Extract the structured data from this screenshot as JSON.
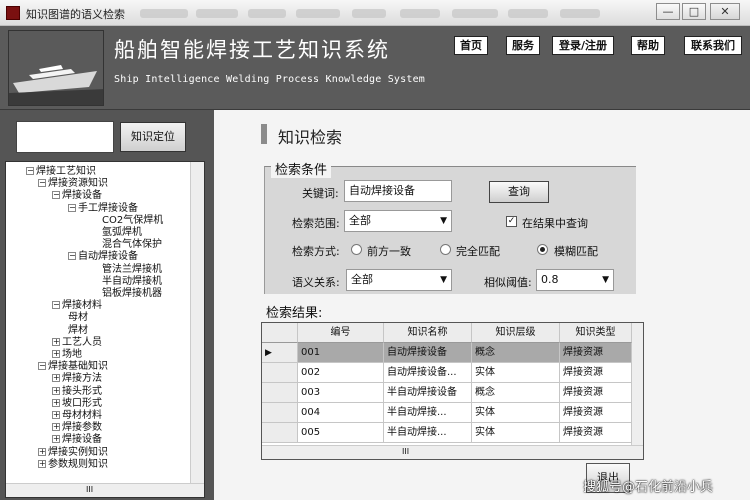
{
  "window": {
    "title": "知识图谱的语义检索",
    "minimize": "—",
    "maximize": "□",
    "close": "✕"
  },
  "header": {
    "title": "船舶智能焊接工艺知识系统",
    "subtitle": "Ship Intelligence Welding Process Knowledge System",
    "nav": [
      "首页",
      "服务",
      "登录/注册",
      "帮助",
      "联系我们"
    ]
  },
  "left": {
    "search_value": "",
    "locate_button": "知识定位",
    "tree": [
      {
        "label": "焊接工艺知识",
        "level": 0,
        "exp": "−"
      },
      {
        "label": "焊接资源知识",
        "level": 1,
        "exp": "−"
      },
      {
        "label": "焊接设备",
        "level": 2,
        "exp": "−"
      },
      {
        "label": "手工焊接设备",
        "level": 3,
        "exp": "−"
      },
      {
        "label": "CO2气保焊机",
        "level": 4,
        "exp": ""
      },
      {
        "label": "氩弧焊机",
        "level": 4,
        "exp": ""
      },
      {
        "label": "混合气体保护",
        "level": 4,
        "exp": ""
      },
      {
        "label": "自动焊接设备",
        "level": 3,
        "exp": "−"
      },
      {
        "label": "管法兰焊接机",
        "level": 4,
        "exp": ""
      },
      {
        "label": "半自动焊接机",
        "level": 4,
        "exp": ""
      },
      {
        "label": "铝板焊接机器",
        "level": 4,
        "exp": ""
      },
      {
        "label": "焊接材料",
        "level": 2,
        "exp": "−"
      },
      {
        "label": "母材",
        "level": 3,
        "exp": ""
      },
      {
        "label": "焊材",
        "level": 3,
        "exp": ""
      },
      {
        "label": "工艺人员",
        "level": 2,
        "exp": "+"
      },
      {
        "label": "场地",
        "level": 2,
        "exp": "+"
      },
      {
        "label": "焊接基础知识",
        "level": 1,
        "exp": "−"
      },
      {
        "label": "焊接方法",
        "level": 2,
        "exp": "+"
      },
      {
        "label": "接头形式",
        "level": 2,
        "exp": "+"
      },
      {
        "label": "坡口形式",
        "level": 2,
        "exp": "+"
      },
      {
        "label": "母材材料",
        "level": 2,
        "exp": "+"
      },
      {
        "label": "焊接参数",
        "level": 2,
        "exp": "+"
      },
      {
        "label": "焊接设备",
        "level": 2,
        "exp": "+"
      },
      {
        "label": "焊接实例知识",
        "level": 1,
        "exp": "+"
      },
      {
        "label": "参数规则知识",
        "level": 1,
        "exp": "+"
      }
    ],
    "hscroll": "III"
  },
  "content": {
    "section_title": "知识检索",
    "conditions": {
      "legend": "检索条件",
      "keyword_label": "关键词:",
      "keyword_value": "自动焊接设备",
      "query_button": "查询",
      "scope_label": "检索范围:",
      "scope_value": "全部",
      "in_results_label": "在结果中查询",
      "in_results_checked": "✓",
      "mode_label": "检索方式:",
      "modes": [
        "前方一致",
        "完全匹配",
        "模糊匹配"
      ],
      "mode_selected": 2,
      "relation_label": "语义关系:",
      "relation_value": "全部",
      "threshold_label": "相似阈值:",
      "threshold_value": "0.8"
    },
    "results": {
      "title": "检索结果:",
      "columns": [
        "编号",
        "知识名称",
        "知识层级",
        "知识类型"
      ],
      "rows": [
        [
          "001",
          "自动焊接设备",
          "概念",
          "焊接资源"
        ],
        [
          "002",
          "自动焊接设备...",
          "实体",
          "焊接资源"
        ],
        [
          "003",
          "半自动焊接设备",
          "概念",
          "焊接资源"
        ],
        [
          "004",
          "半自动焊接...",
          "实体",
          "焊接资源"
        ],
        [
          "005",
          "半自动焊接...",
          "实体",
          "焊接资源"
        ]
      ],
      "selected_row": 0,
      "hscroll": "III"
    },
    "exit_button": "退出"
  },
  "watermark": "搜狐号@石化前沿小兵",
  "colors": {
    "header_bg": "#5b5b5b",
    "left_bg": "#555555",
    "selected_row": "#a9a9a9"
  }
}
